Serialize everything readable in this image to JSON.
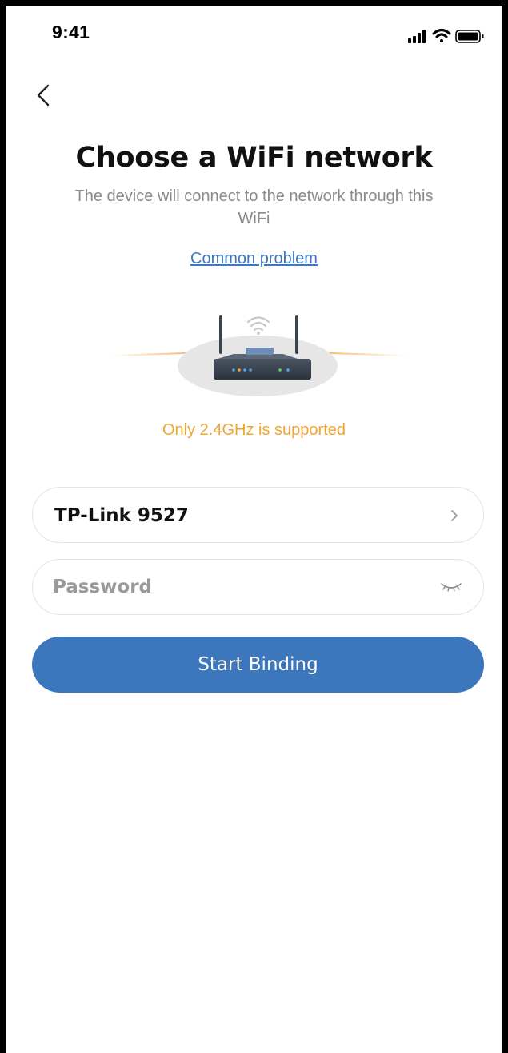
{
  "status_bar": {
    "time": "9:41",
    "icons": [
      "signal-icon",
      "wifi-icon",
      "battery-icon"
    ]
  },
  "header": {
    "back_icon": "chevron-left-icon",
    "title": "Choose a WiFi network",
    "subtitle": "The device will connect to the network through this WiFi",
    "help_link": "Common problem"
  },
  "illustration": {
    "icon": "router-icon",
    "note": "Only 2.4GHz is supported"
  },
  "form": {
    "ssid": {
      "value": "TP-Link 9527",
      "icon": "chevron-right-icon"
    },
    "password": {
      "placeholder": "Password",
      "value": "",
      "icon": "eye-closed-icon"
    },
    "submit_label": "Start Binding"
  },
  "colors": {
    "accent": "#3c77be",
    "link": "#3c78c2",
    "warning": "#f0a531",
    "muted_text": "#8a8a8a",
    "border": "#e3e3e3"
  }
}
